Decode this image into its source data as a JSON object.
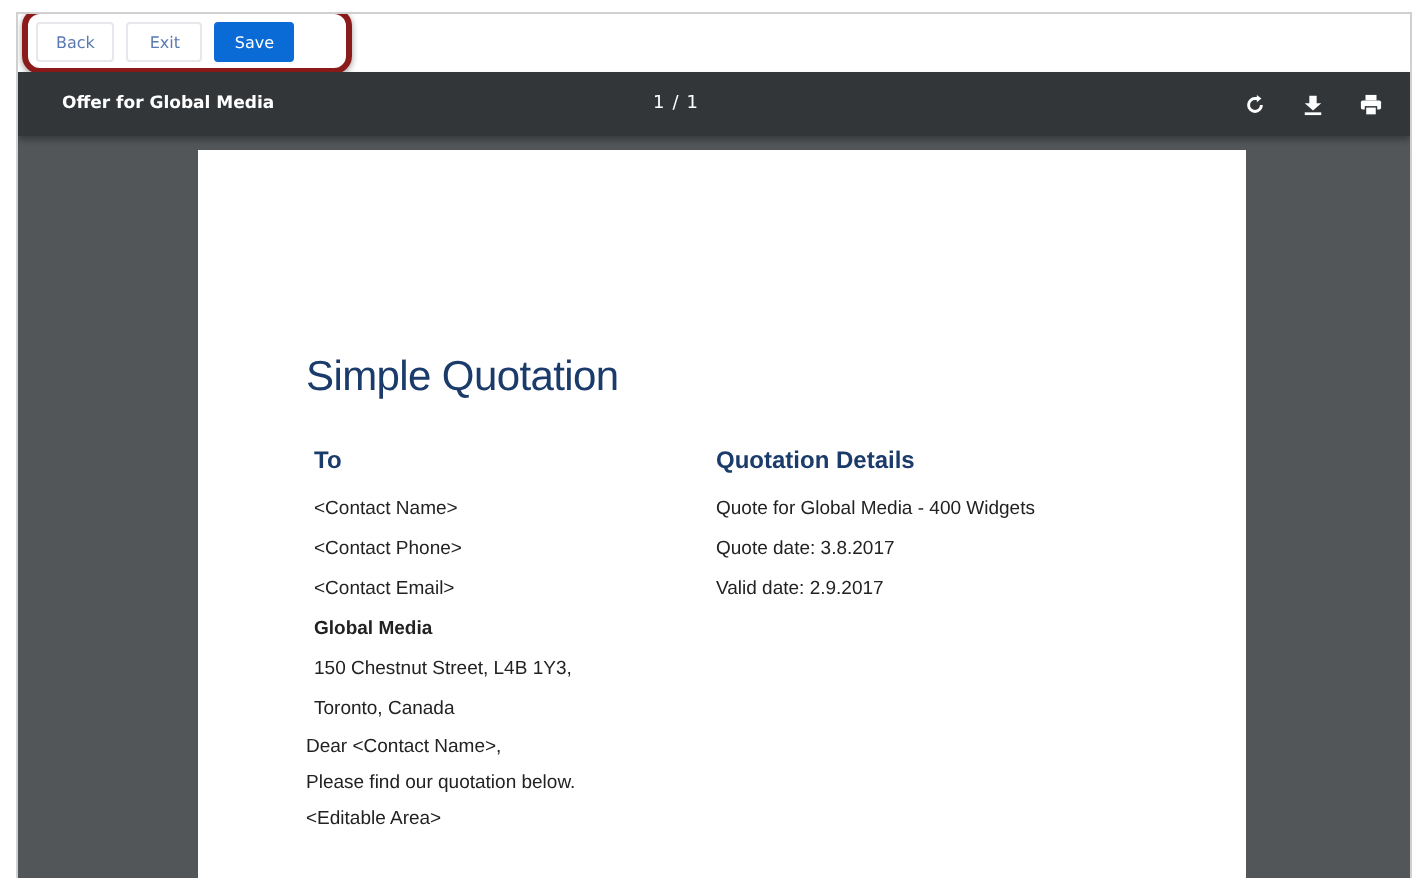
{
  "toolbar": {
    "buttons": [
      {
        "label": "Back",
        "kind": "plain"
      },
      {
        "label": "Exit",
        "kind": "plain"
      },
      {
        "label": "Save",
        "kind": "primary"
      }
    ],
    "highlighted": true
  },
  "viewer": {
    "title": "Offer for Global Media",
    "page": "1",
    "page_separator": "/",
    "page_count": "1"
  },
  "document": {
    "title": "Simple Quotation",
    "to": {
      "heading": "To",
      "lines": [
        {
          "text": "<Contact Name>",
          "bold": false
        },
        {
          "text": "<Contact Phone>",
          "bold": false
        },
        {
          "text": "<Contact Email>",
          "bold": false
        },
        {
          "text": "Global Media",
          "bold": true
        },
        {
          "text": "150 Chestnut Street, L4B 1Y3,",
          "bold": false
        },
        {
          "text": "Toronto, Canada",
          "bold": false
        }
      ]
    },
    "details": {
      "heading": "Quotation Details",
      "lines": [
        "Quote for Global Media - 400 Widgets",
        "Quote date: 3.8.2017",
        "Valid date: 2.9.2017"
      ]
    },
    "body": [
      "Dear <Contact Name>,",
      "Please find our quotation below.",
      "<Editable Area>"
    ]
  }
}
